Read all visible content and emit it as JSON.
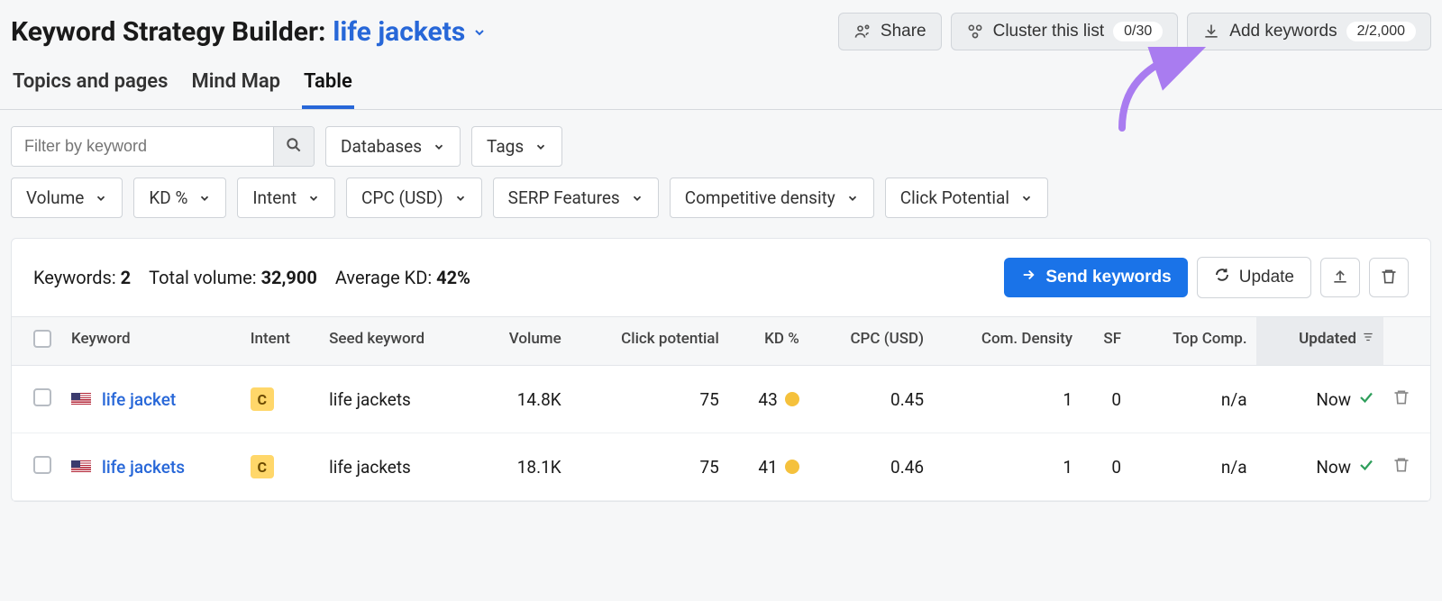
{
  "header": {
    "title_prefix": "Keyword Strategy Builder:",
    "keyword": "life jackets",
    "share": "Share",
    "cluster": "Cluster this list",
    "cluster_count": "0/30",
    "add_keywords": "Add keywords",
    "add_count": "2/2,000"
  },
  "tabs": {
    "topics": "Topics and pages",
    "mindmap": "Mind Map",
    "table": "Table"
  },
  "filters": {
    "search_placeholder": "Filter by keyword",
    "databases": "Databases",
    "tags": "Tags",
    "volume": "Volume",
    "kd": "KD %",
    "intent": "Intent",
    "cpc": "CPC (USD)",
    "serp": "SERP Features",
    "compdens": "Competitive density",
    "clickpot": "Click Potential"
  },
  "panel": {
    "keywords_label": "Keywords: ",
    "keywords_value": "2",
    "totalvol_label": "Total volume: ",
    "totalvol_value": "32,900",
    "avgkd_label": "Average KD: ",
    "avgkd_value": "42%",
    "send": "Send keywords",
    "update": "Update"
  },
  "columns": {
    "keyword": "Keyword",
    "intent": "Intent",
    "seed": "Seed keyword",
    "volume": "Volume",
    "clickpot": "Click potential",
    "kd": "KD %",
    "cpc": "CPC (USD)",
    "comdens": "Com. Density",
    "sf": "SF",
    "topcomp": "Top Comp.",
    "updated": "Updated"
  },
  "rows": [
    {
      "keyword": "life jacket",
      "intent": "C",
      "seed": "life jackets",
      "volume": "14.8K",
      "clickpot": "75",
      "kd": "43",
      "cpc": "0.45",
      "comdens": "1",
      "sf": "0",
      "topcomp": "n/a",
      "updated": "Now"
    },
    {
      "keyword": "life jackets",
      "intent": "C",
      "seed": "life jackets",
      "volume": "18.1K",
      "clickpot": "75",
      "kd": "41",
      "cpc": "0.46",
      "comdens": "1",
      "sf": "0",
      "topcomp": "n/a",
      "updated": "Now"
    }
  ]
}
